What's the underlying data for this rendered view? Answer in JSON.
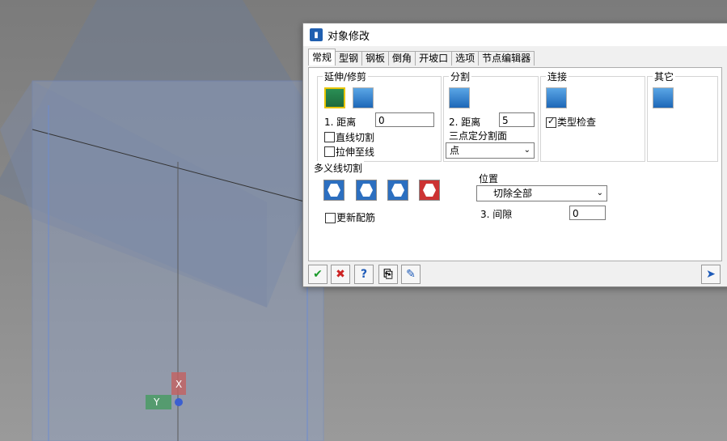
{
  "window": {
    "title": "对象修改"
  },
  "tabs": [
    "常规",
    "型钢",
    "钢板",
    "倒角",
    "开坡口",
    "选项",
    "节点编辑器"
  ],
  "groups": {
    "extend_trim": {
      "title": "延伸/修剪",
      "distance_label": "1. 距离",
      "distance_value": "0",
      "check_straight_cut": "直线切割",
      "check_stretch_to_line": "拉伸至线"
    },
    "split": {
      "title": "分割",
      "distance_label": "2. 距离",
      "distance_value": "5",
      "three_point_label": "三点定分割面",
      "three_point_select": "点"
    },
    "connect": {
      "title": "连接",
      "type_check_label": "类型检查"
    },
    "other": {
      "title": "其它"
    },
    "polyline_cut": {
      "title": "多义线切割",
      "update_rebar_label": "更新配筋",
      "position_label": "位置",
      "position_select": "切除全部",
      "gap_label": "3. 间隙",
      "gap_value": "0"
    }
  },
  "icons": [
    "check-icon",
    "cancel-icon",
    "help-icon",
    "copy-icon",
    "edit-icon",
    "pin-icon"
  ]
}
